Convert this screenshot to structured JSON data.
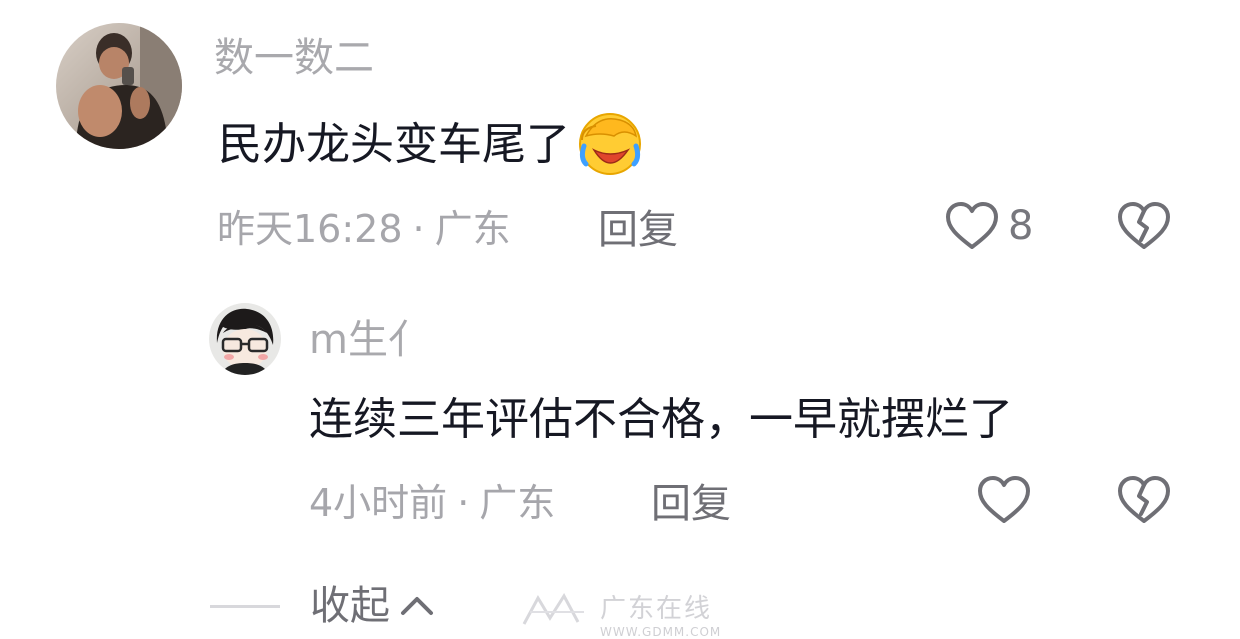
{
  "comment": {
    "username": "数一数二",
    "text": "民办龙头变车尾了",
    "emoji_icon": "laughing-crying-face-icon",
    "time": "昨天16:28",
    "separator": "·",
    "location": "广东",
    "reply_label": "回复",
    "like_count": "8",
    "like_icon": "heart-outline-icon",
    "dislike_icon": "broken-heart-icon"
  },
  "reply": {
    "username": "m生亻",
    "text": "连续三年评估不合格，一早就摆烂了",
    "time": "4小时前",
    "separator": "·",
    "location": "广东",
    "reply_label": "回复",
    "like_icon": "heart-outline-icon",
    "dislike_icon": "broken-heart-icon"
  },
  "collapse": {
    "label": "收起",
    "icon": "chevron-up-icon"
  },
  "watermark": {
    "text": "广东在线",
    "url": "WWW.GDMM.COM"
  },
  "colors": {
    "primary_text": "#161823",
    "secondary_text": "#a9a9ad",
    "action_text": "#6f6f75",
    "background": "#ffffff"
  }
}
